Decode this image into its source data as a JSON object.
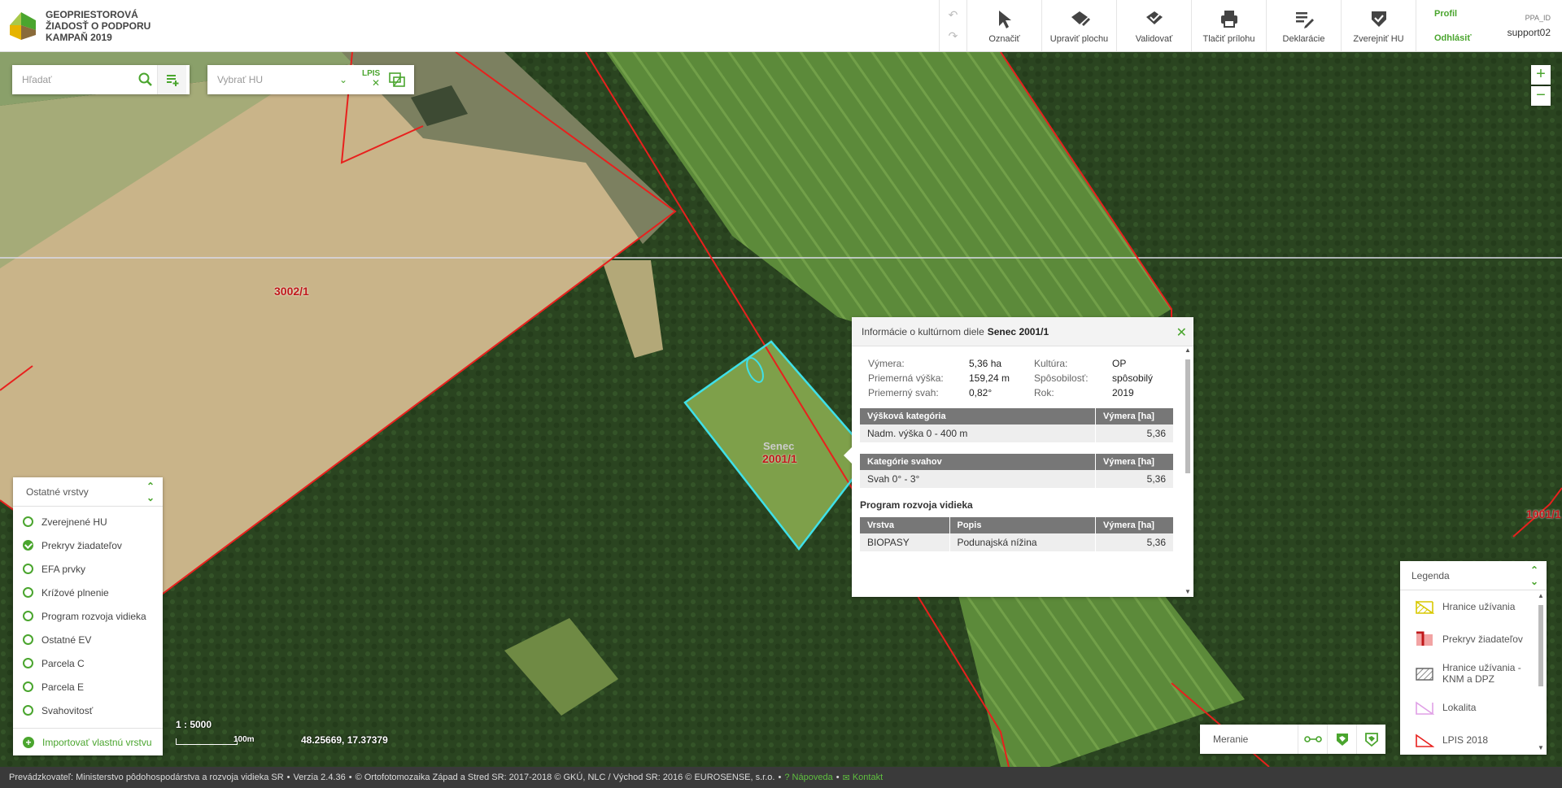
{
  "app": {
    "title_lines": [
      "GEOPRIESTOROVÁ",
      "ŽIADOSŤ O PODPORU",
      "KAMPAŇ 2019"
    ]
  },
  "toolbar": {
    "select_label": "Označiť",
    "edit_area_label": "Upraviť plochu",
    "validate_label": "Validovať",
    "print_label": "Tlačiť prílohu",
    "declarations_label": "Deklarácie",
    "publish_label": "Zverejniť HU",
    "profile_label": "Profil",
    "logout_label": "Odhlásiť",
    "user_id_label": "PPA_ID",
    "username": "support02"
  },
  "search": {
    "placeholder": "Hľadať"
  },
  "hu_select": {
    "placeholder": "Vybrať HU",
    "lpis_label": "LPIS"
  },
  "map": {
    "parcel_labels": [
      "3002/1",
      "2001/1",
      "1001/1"
    ],
    "selected_locality": "Senec",
    "scale_text": "1 : 5000",
    "scalebar_label": "100m",
    "coordinates": "48.25669, 17.37379"
  },
  "popup": {
    "title_prefix": "Informácie o kultúrnom diele",
    "title_name": "Senec 2001/1",
    "attributes": {
      "area_label": "Výmera:",
      "area_value": "5,36 ha",
      "culture_label": "Kultúra:",
      "culture_value": "OP",
      "avg_height_label": "Priemerná výška:",
      "avg_height_value": "159,24 m",
      "method_label": "Spôsobilosť:",
      "method_value": "spôsobilý",
      "avg_slope_label": "Priemerný svah:",
      "avg_slope_value": "0,82°",
      "year_label": "Rok:",
      "year_value": "2019"
    },
    "height_table": {
      "headers": [
        "Výšková kategória",
        "Výmera [ha]"
      ],
      "rows": [
        [
          "Nadm. výška 0 - 400 m",
          "5,36"
        ]
      ]
    },
    "slope_table": {
      "headers": [
        "Kategórie svahov",
        "Výmera [ha]"
      ],
      "rows": [
        [
          "Svah 0° - 3°",
          "5,36"
        ]
      ]
    },
    "rural_section_title": "Program rozvoja vidieka",
    "rural_table": {
      "headers": [
        "Vrstva",
        "Popis",
        "Výmera [ha]"
      ],
      "rows": [
        [
          "BIOPASY",
          "Podunajská nížina",
          "5,36"
        ]
      ]
    }
  },
  "layers": {
    "title": "Ostatné vrstvy",
    "items": [
      {
        "label": "Zverejnené HU",
        "checked": false
      },
      {
        "label": "Prekryv žiadateľov",
        "checked": true
      },
      {
        "label": "EFA prvky",
        "checked": false
      },
      {
        "label": "Krížové plnenie",
        "checked": false
      },
      {
        "label": "Program rozvoja vidieka",
        "checked": false
      },
      {
        "label": "Ostatné EV",
        "checked": false
      },
      {
        "label": "Parcela C",
        "checked": false
      },
      {
        "label": "Parcela E",
        "checked": false
      },
      {
        "label": "Svahovitosť",
        "checked": false
      }
    ],
    "import_label": "Importovať vlastnú vrstvu"
  },
  "measure": {
    "label": "Meranie"
  },
  "legend": {
    "title": "Legenda",
    "items": [
      {
        "label": "Hranice užívania",
        "icon": "hatched-yellow"
      },
      {
        "label": "Prekryv žiadateľov",
        "icon": "hatched-red"
      },
      {
        "label": "Hranice užívania - KNM a DPZ",
        "icon": "hatched-gray"
      },
      {
        "label": "Lokalita",
        "icon": "outline-pink"
      },
      {
        "label": "LPIS 2018",
        "icon": "outline-red"
      }
    ]
  },
  "footer": {
    "operator": "Prevádzkovateľ: Ministerstvo pôdohospodárstva a rozvoja vidieka SR",
    "version": "Verzia 2.4.36",
    "copyright": "© Ortofotomozaika Západ a Stred SR: 2017-2018 © GKÚ, NLC / Východ SR: 2016 © EUROSENSE, s.r.o.",
    "help_label": "Nápoveda",
    "contact_label": "Kontakt"
  },
  "colors": {
    "accent": "#4aa52e",
    "parcel_border": "#e8201d",
    "selected_parcel": "#3fe0e8"
  }
}
